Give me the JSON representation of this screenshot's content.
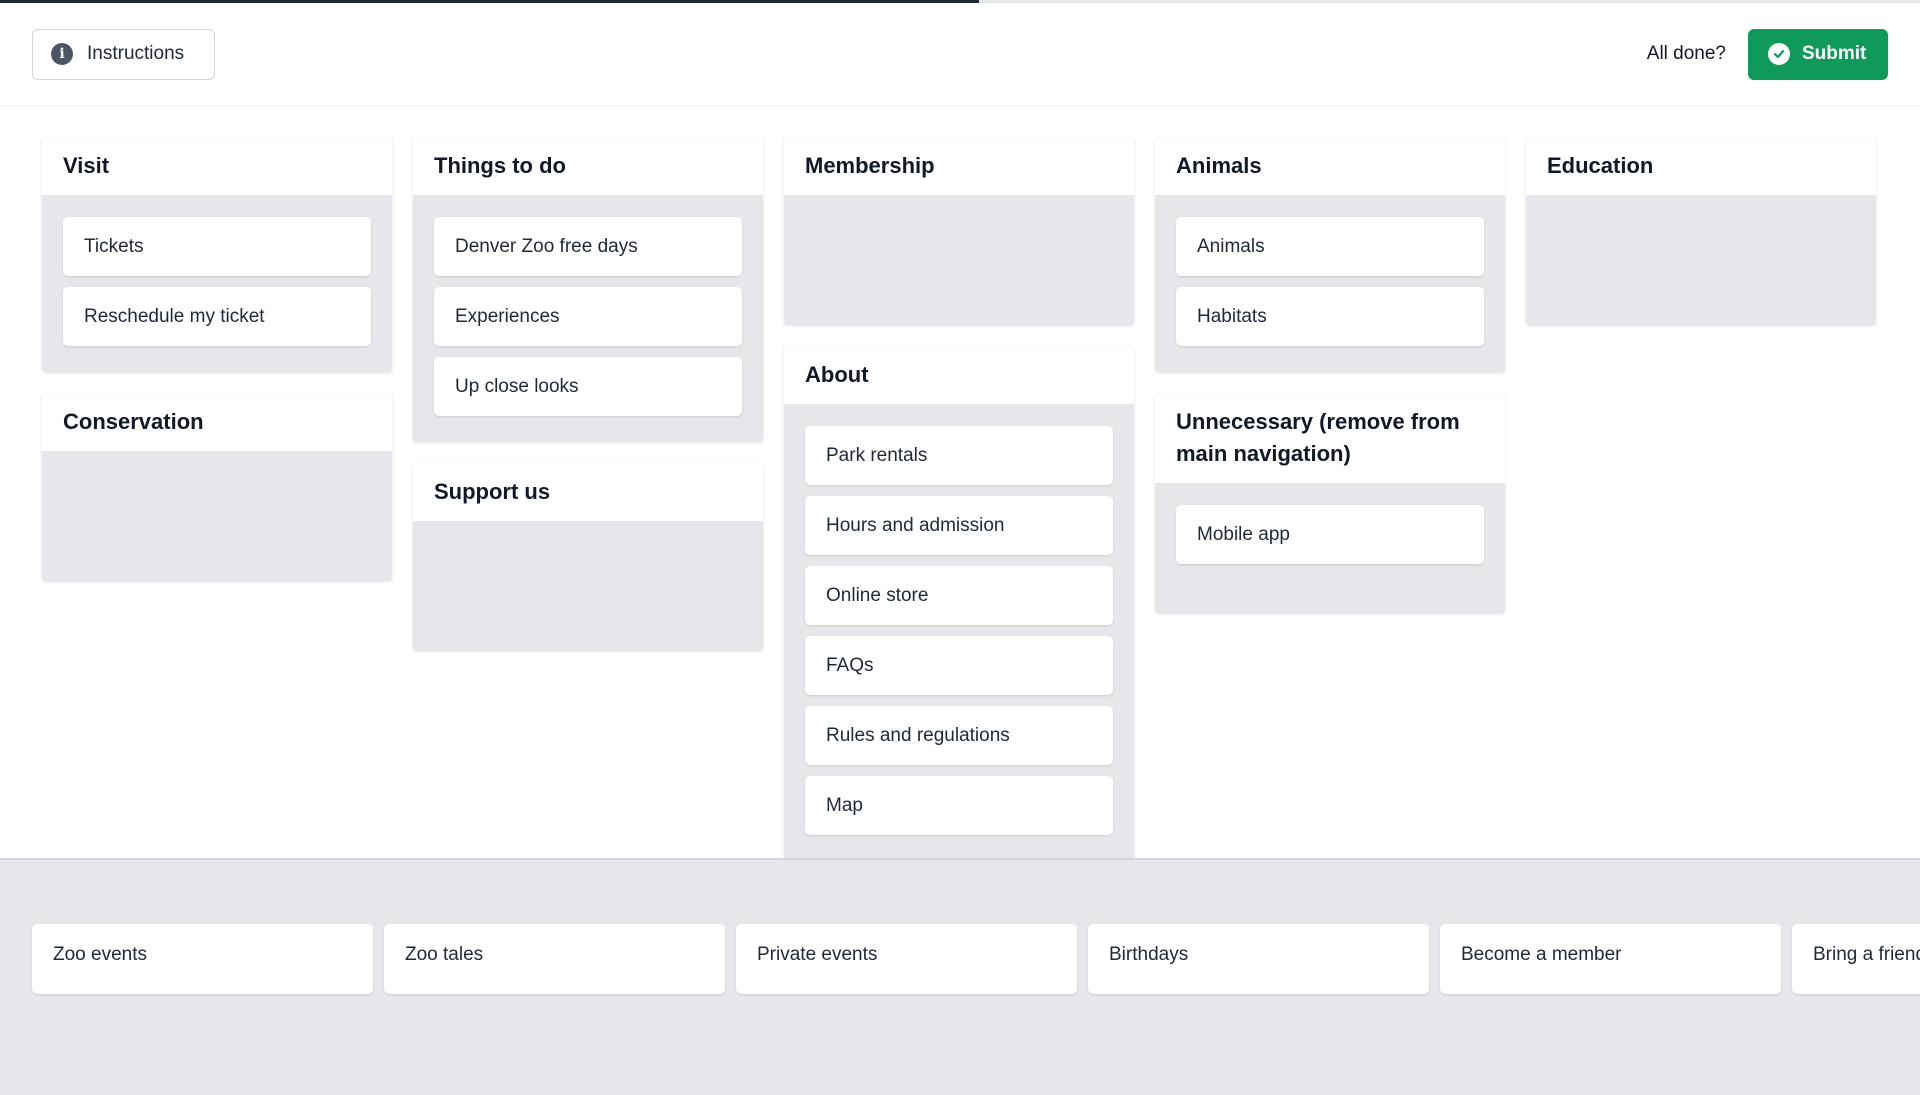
{
  "progress": 0.51,
  "header": {
    "instructions_label": "Instructions",
    "all_done_label": "All done?",
    "submit_label": "Submit",
    "submit_color": "#0f9a5b"
  },
  "columns": [
    {
      "groups": [
        {
          "title": "Visit",
          "cards": [
            "Tickets",
            "Reschedule my ticket"
          ]
        },
        {
          "title": "Conservation",
          "cards": []
        }
      ]
    },
    {
      "groups": [
        {
          "title": "Things to do",
          "cards": [
            "Denver Zoo free days",
            "Experiences",
            "Up close looks"
          ]
        },
        {
          "title": "Support us",
          "cards": []
        }
      ]
    },
    {
      "groups": [
        {
          "title": "Membership",
          "cards": []
        },
        {
          "title": "About",
          "cards": [
            "Park rentals",
            "Hours and admission",
            "Online store",
            "FAQs",
            "Rules and regulations",
            "Map"
          ]
        }
      ]
    },
    {
      "groups": [
        {
          "title": "Animals",
          "cards": [
            "Animals",
            "Habitats"
          ]
        },
        {
          "title": "Unnecessary (remove from main navigation)",
          "cards": [
            "Mobile app"
          ]
        }
      ]
    },
    {
      "groups": [
        {
          "title": "Education",
          "cards": []
        }
      ]
    }
  ],
  "tray": {
    "cards": [
      "Zoo events",
      "Zoo tales",
      "Private events",
      "Birthdays",
      "Become a member",
      "Bring a friend days)"
    ]
  }
}
